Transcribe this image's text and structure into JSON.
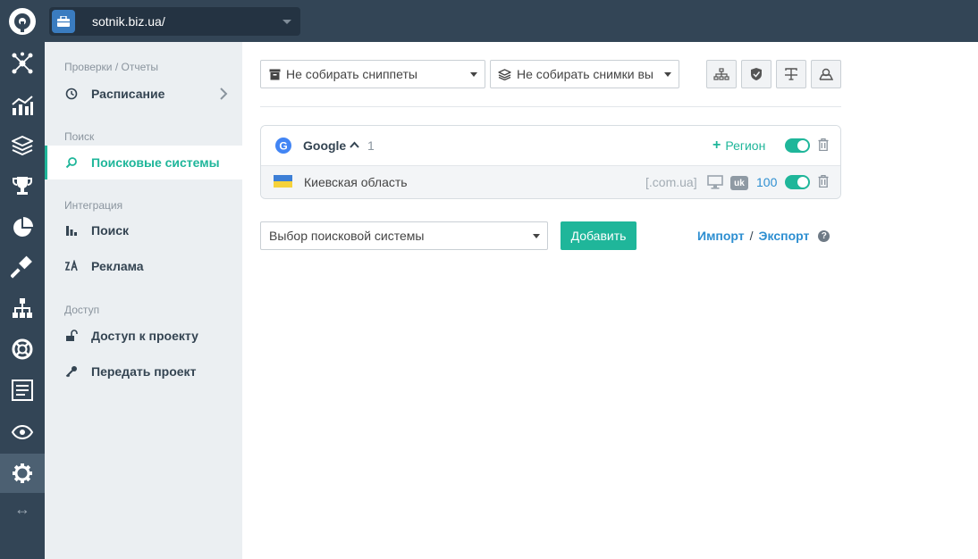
{
  "topbar": {
    "project_name": "sotnik.biz.ua/"
  },
  "rail": {
    "items": [
      "network-icon",
      "chart-icon",
      "layers-icon",
      "trophy-icon",
      "pie-chart-icon",
      "gavel-icon",
      "sitemap-icon",
      "lifebuoy-icon",
      "report-icon",
      "eye-icon",
      "gear-icon"
    ],
    "resize_glyph": "↔"
  },
  "subnav": {
    "sections": [
      {
        "title": "Проверки / Отчеты",
        "items": [
          {
            "label": "Расписание",
            "icon": "clock-icon"
          }
        ]
      },
      {
        "title": "Поиск",
        "items": [
          {
            "label": "Поисковые системы",
            "icon": "search-icon"
          }
        ]
      },
      {
        "title": "Интеграция",
        "items": [
          {
            "label": "Поиск",
            "icon": "bar-chart-icon"
          },
          {
            "label": "Реклама",
            "icon": "ad-icon"
          }
        ]
      },
      {
        "title": "Доступ",
        "items": [
          {
            "label": "Доступ к проекту",
            "icon": "unlock-icon"
          },
          {
            "label": "Передать проект",
            "icon": "key-icon"
          }
        ]
      }
    ]
  },
  "main": {
    "snippets_select": "Не собирать сниппеты",
    "screenshots_select": "Не собирать снимки вы",
    "engine": {
      "name": "Google",
      "count": "1",
      "add_region_label": "Регион",
      "region": {
        "name": "Киевская область",
        "domain": "[.com.ua]",
        "lang": "uk",
        "depth": "100"
      }
    },
    "engine_select_placeholder": "Выбор поисковой системы",
    "add_button": "Добавить",
    "import_label": "Импорт",
    "separator": "/",
    "export_label": "Экспорт"
  },
  "colors": {
    "accent": "#1fb69a",
    "rail_bg": "#334556",
    "link": "#2e8fd1"
  }
}
